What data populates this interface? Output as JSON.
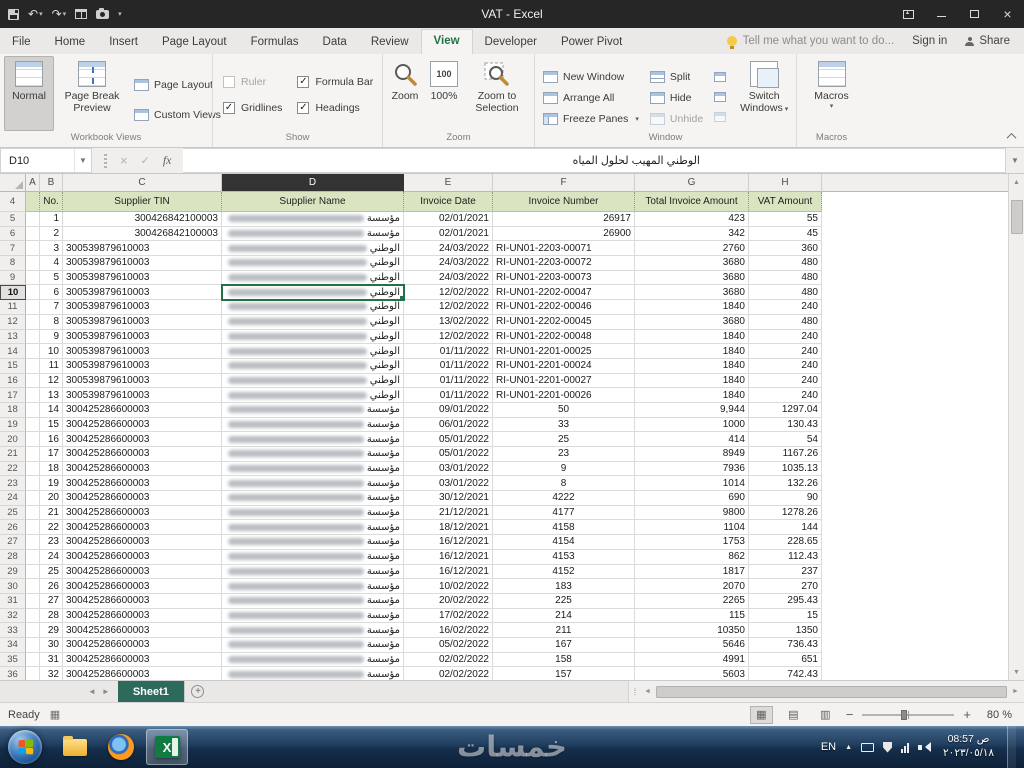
{
  "titlebar": {
    "title": "VAT - Excel",
    "qat_icons": [
      "save-icon",
      "undo-icon",
      "redo-icon",
      "table-icon",
      "camera-icon",
      "customize-qat-dropdown-icon"
    ],
    "window_control_icons": [
      "ribbon-display-options-icon",
      "minimize-icon",
      "maximize-icon",
      "close-icon"
    ]
  },
  "ribbon": {
    "tabs": [
      "File",
      "Home",
      "Insert",
      "Page Layout",
      "Formulas",
      "Data",
      "Review",
      "View",
      "Developer",
      "Power Pivot"
    ],
    "active_tab": "View",
    "tell_me": "Tell me what you want to do...",
    "sign_in": "Sign in",
    "share": "Share",
    "workbook_views": {
      "normal": "Normal",
      "page_break_preview": "Page Break Preview",
      "page_layout": "Page Layout",
      "custom_views": "Custom Views"
    },
    "show": {
      "items": [
        {
          "label": "Ruler",
          "checked": false,
          "disabled": true
        },
        {
          "label": "Gridlines",
          "checked": true,
          "disabled": false
        },
        {
          "label": "Formula Bar",
          "checked": true,
          "disabled": false
        },
        {
          "label": "Headings",
          "checked": true,
          "disabled": false
        }
      ]
    },
    "zoom": {
      "zoom": "Zoom",
      "hundred": "100%",
      "selection": "Zoom to Selection"
    },
    "window": {
      "new_window": "New Window",
      "arrange_all": "Arrange All",
      "freeze_panes": "Freeze Panes",
      "split": "Split",
      "hide": "Hide",
      "unhide": "Unhide",
      "switch_windows": "Switch Windows"
    },
    "macros": {
      "macros": "Macros"
    },
    "group_labels": {
      "workbook_views": "Workbook Views",
      "show": "Show",
      "zoom": "Zoom",
      "window": "Window",
      "macros": "Macros"
    }
  },
  "formula_bar": {
    "name_box": "D10",
    "fx_label": "fx",
    "value": "الوطني المهيب لحلول المياه"
  },
  "grid": {
    "columns": [
      "A",
      "B",
      "C",
      "D",
      "E",
      "F",
      "G",
      "H"
    ],
    "selected_cell": "D10",
    "selected_column": "D",
    "selected_row": 10,
    "first_row_number": 4,
    "header_row": [
      "No.",
      "Supplier TIN",
      "Supplier Name",
      "Invoice Date",
      "Invoice Number",
      "Total Invoice Amount",
      "VAT Amount"
    ],
    "rows": [
      {
        "no": "1",
        "tin": "300426842100003",
        "tin_align": "right",
        "supplier_name": "مؤسسة",
        "invoice_date": "02/01/2021",
        "invoice_number": "26917",
        "invoice_align": "right",
        "total_amount": "423",
        "vat_amount": "55"
      },
      {
        "no": "2",
        "tin": "300426842100003",
        "tin_align": "right",
        "supplier_name": "مؤسسة",
        "invoice_date": "02/01/2021",
        "invoice_number": "26900",
        "invoice_align": "right",
        "total_amount": "342",
        "vat_amount": "45"
      },
      {
        "no": "3",
        "tin": "300539879610003",
        "tin_align": "left",
        "supplier_name": "الوطني",
        "invoice_date": "24/03/2022",
        "invoice_number": "RI-UN01-2203-00071",
        "invoice_align": "left",
        "total_amount": "2760",
        "vat_amount": "360"
      },
      {
        "no": "4",
        "tin": "300539879610003",
        "tin_align": "left",
        "supplier_name": "الوطني",
        "invoice_date": "24/03/2022",
        "invoice_number": "RI-UN01-2203-00072",
        "invoice_align": "left",
        "total_amount": "3680",
        "vat_amount": "480"
      },
      {
        "no": "5",
        "tin": "300539879610003",
        "tin_align": "left",
        "supplier_name": "الوطني",
        "invoice_date": "24/03/2022",
        "invoice_number": "RI-UN01-2203-00073",
        "invoice_align": "left",
        "total_amount": "3680",
        "vat_amount": "480"
      },
      {
        "no": "6",
        "tin": "300539879610003",
        "tin_align": "left",
        "supplier_name": "الوطني",
        "invoice_date": "12/02/2022",
        "invoice_number": "RI-UN01-2202-00047",
        "invoice_align": "left",
        "total_amount": "3680",
        "vat_amount": "480"
      },
      {
        "no": "7",
        "tin": "300539879610003",
        "tin_align": "left",
        "supplier_name": "الوطني",
        "invoice_date": "12/02/2022",
        "invoice_number": "RI-UN01-2202-00046",
        "invoice_align": "left",
        "total_amount": "1840",
        "vat_amount": "240"
      },
      {
        "no": "8",
        "tin": "300539879610003",
        "tin_align": "left",
        "supplier_name": "الوطني",
        "invoice_date": "13/02/2022",
        "invoice_number": "RI-UN01-2202-00045",
        "invoice_align": "left",
        "total_amount": "3680",
        "vat_amount": "480"
      },
      {
        "no": "9",
        "tin": "300539879610003",
        "tin_align": "left",
        "supplier_name": "الوطني",
        "invoice_date": "12/02/2022",
        "invoice_number": "RI-UN01-2202-00048",
        "invoice_align": "left",
        "total_amount": "1840",
        "vat_amount": "240"
      },
      {
        "no": "10",
        "tin": "300539879610003",
        "tin_align": "left",
        "supplier_name": "الوطني",
        "invoice_date": "01/11/2022",
        "invoice_number": "RI-UN01-2201-00025",
        "invoice_align": "left",
        "total_amount": "1840",
        "vat_amount": "240"
      },
      {
        "no": "11",
        "tin": "300539879610003",
        "tin_align": "left",
        "supplier_name": "الوطني",
        "invoice_date": "01/11/2022",
        "invoice_number": "RI-UN01-2201-00024",
        "invoice_align": "left",
        "total_amount": "1840",
        "vat_amount": "240"
      },
      {
        "no": "12",
        "tin": "300539879610003",
        "tin_align": "left",
        "supplier_name": "الوطني",
        "invoice_date": "01/11/2022",
        "invoice_number": "RI-UN01-2201-00027",
        "invoice_align": "left",
        "total_amount": "1840",
        "vat_amount": "240"
      },
      {
        "no": "13",
        "tin": "300539879610003",
        "tin_align": "left",
        "supplier_name": "الوطني",
        "invoice_date": "01/11/2022",
        "invoice_number": "RI-UN01-2201-00026",
        "invoice_align": "left",
        "total_amount": "1840",
        "vat_amount": "240"
      },
      {
        "no": "14",
        "tin": "300425286600003",
        "tin_align": "left",
        "supplier_name": "مؤسسة",
        "invoice_date": "09/01/2022",
        "invoice_number": "50",
        "invoice_align": "center",
        "total_amount": "9,944",
        "vat_amount": "1297.04"
      },
      {
        "no": "15",
        "tin": "300425286600003",
        "tin_align": "left",
        "supplier_name": "مؤسسة",
        "invoice_date": "06/01/2022",
        "invoice_number": "33",
        "invoice_align": "center",
        "total_amount": "1000",
        "vat_amount": "130.43"
      },
      {
        "no": "16",
        "tin": "300425286600003",
        "tin_align": "left",
        "supplier_name": "مؤسسة",
        "invoice_date": "05/01/2022",
        "invoice_number": "25",
        "invoice_align": "center",
        "total_amount": "414",
        "vat_amount": "54"
      },
      {
        "no": "17",
        "tin": "300425286600003",
        "tin_align": "left",
        "supplier_name": "مؤسسة",
        "invoice_date": "05/01/2022",
        "invoice_number": "23",
        "invoice_align": "center",
        "total_amount": "8949",
        "vat_amount": "1167.26"
      },
      {
        "no": "18",
        "tin": "300425286600003",
        "tin_align": "left",
        "supplier_name": "مؤسسة",
        "invoice_date": "03/01/2022",
        "invoice_number": "9",
        "invoice_align": "center",
        "total_amount": "7936",
        "vat_amount": "1035.13"
      },
      {
        "no": "19",
        "tin": "300425286600003",
        "tin_align": "left",
        "supplier_name": "مؤسسة",
        "invoice_date": "03/01/2022",
        "invoice_number": "8",
        "invoice_align": "center",
        "total_amount": "1014",
        "vat_amount": "132.26"
      },
      {
        "no": "20",
        "tin": "300425286600003",
        "tin_align": "left",
        "supplier_name": "مؤسسة",
        "invoice_date": "30/12/2021",
        "invoice_number": "4222",
        "invoice_align": "center",
        "total_amount": "690",
        "vat_amount": "90"
      },
      {
        "no": "21",
        "tin": "300425286600003",
        "tin_align": "left",
        "supplier_name": "مؤسسة",
        "invoice_date": "21/12/2021",
        "invoice_number": "4177",
        "invoice_align": "center",
        "total_amount": "9800",
        "vat_amount": "1278.26"
      },
      {
        "no": "22",
        "tin": "300425286600003",
        "tin_align": "left",
        "supplier_name": "مؤسسة",
        "invoice_date": "18/12/2021",
        "invoice_number": "4158",
        "invoice_align": "center",
        "total_amount": "1104",
        "vat_amount": "144"
      },
      {
        "no": "23",
        "tin": "300425286600003",
        "tin_align": "left",
        "supplier_name": "مؤسسة",
        "invoice_date": "16/12/2021",
        "invoice_number": "4154",
        "invoice_align": "center",
        "total_amount": "1753",
        "vat_amount": "228.65"
      },
      {
        "no": "24",
        "tin": "300425286600003",
        "tin_align": "left",
        "supplier_name": "مؤسسة",
        "invoice_date": "16/12/2021",
        "invoice_number": "4153",
        "invoice_align": "center",
        "total_amount": "862",
        "vat_amount": "112.43"
      },
      {
        "no": "25",
        "tin": "300425286600003",
        "tin_align": "left",
        "supplier_name": "مؤسسة",
        "invoice_date": "16/12/2021",
        "invoice_number": "4152",
        "invoice_align": "center",
        "total_amount": "1817",
        "vat_amount": "237"
      },
      {
        "no": "26",
        "tin": "300425286600003",
        "tin_align": "left",
        "supplier_name": "مؤسسة",
        "invoice_date": "10/02/2022",
        "invoice_number": "183",
        "invoice_align": "center",
        "total_amount": "2070",
        "vat_amount": "270"
      },
      {
        "no": "27",
        "tin": "300425286600003",
        "tin_align": "left",
        "supplier_name": "مؤسسة",
        "invoice_date": "20/02/2022",
        "invoice_number": "225",
        "invoice_align": "center",
        "total_amount": "2265",
        "vat_amount": "295.43"
      },
      {
        "no": "28",
        "tin": "300425286600003",
        "tin_align": "left",
        "supplier_name": "مؤسسة",
        "invoice_date": "17/02/2022",
        "invoice_number": "214",
        "invoice_align": "center",
        "total_amount": "115",
        "vat_amount": "15"
      },
      {
        "no": "29",
        "tin": "300425286600003",
        "tin_align": "left",
        "supplier_name": "مؤسسة",
        "invoice_date": "16/02/2022",
        "invoice_number": "211",
        "invoice_align": "center",
        "total_amount": "10350",
        "vat_amount": "1350"
      },
      {
        "no": "30",
        "tin": "300425286600003",
        "tin_align": "left",
        "supplier_name": "مؤسسة",
        "invoice_date": "05/02/2022",
        "invoice_number": "167",
        "invoice_align": "center",
        "total_amount": "5646",
        "vat_amount": "736.43"
      },
      {
        "no": "31",
        "tin": "300425286600003",
        "tin_align": "left",
        "supplier_name": "مؤسسة",
        "invoice_date": "02/02/2022",
        "invoice_number": "158",
        "invoice_align": "center",
        "total_amount": "4991",
        "vat_amount": "651"
      },
      {
        "no": "32",
        "tin": "300425286600003",
        "tin_align": "left",
        "supplier_name": "مؤسسة",
        "invoice_date": "02/02/2022",
        "invoice_number": "157",
        "invoice_align": "center",
        "total_amount": "5603",
        "vat_amount": "742.43"
      }
    ]
  },
  "sheet_bar": {
    "active_tab": "Sheet1"
  },
  "status_bar": {
    "ready": "Ready",
    "zoom_level": "80 %"
  },
  "taskbar": {
    "language": "EN",
    "time": "08:57 ص",
    "date": "٢٠٢٣/٠٥/١٨",
    "watermark": "خمسات",
    "icons": [
      "start-orb-icon",
      "explorer-icon",
      "firefox-icon",
      "excel-icon",
      "keyboard-icon",
      "shield-icon",
      "network-icon",
      "speaker-icon"
    ]
  }
}
